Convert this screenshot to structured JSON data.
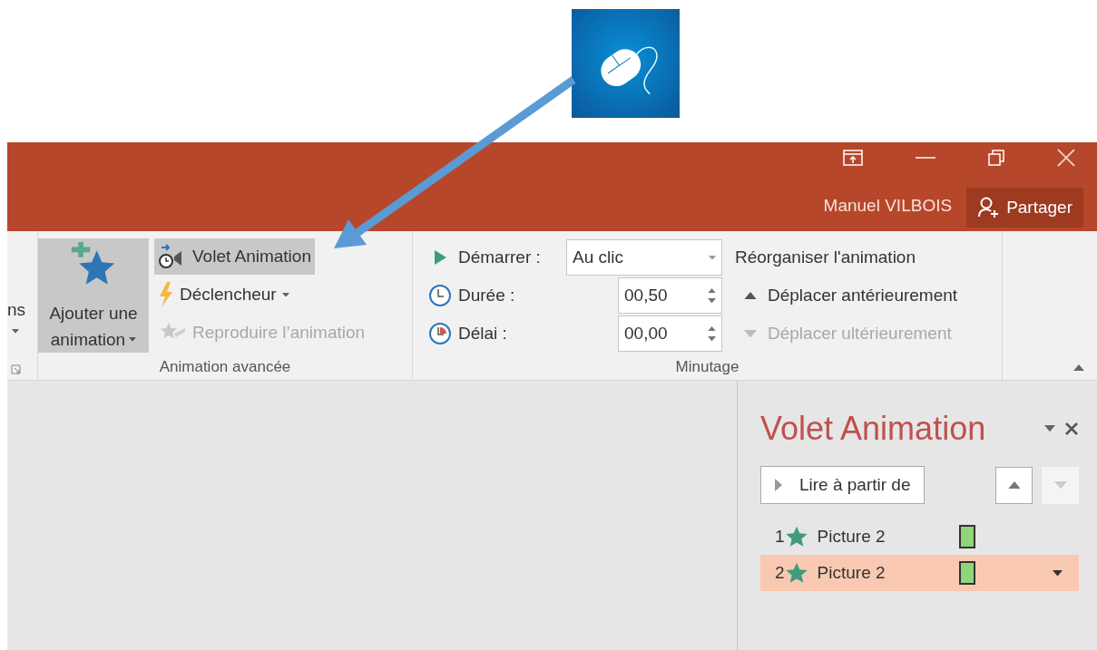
{
  "title_bar": {
    "user": "Manuel VILBOIS",
    "share_button": "Partager"
  },
  "ribbon": {
    "partial_group": {
      "label": "ns"
    },
    "advanced_group": {
      "label": "Animation avancée",
      "add_button": {
        "line1": "Ajouter une",
        "line2": "animation",
        "highlighted": true
      },
      "items": [
        {
          "kind": "pane",
          "label": "Volet Animation",
          "highlighted": true,
          "disabled": false
        },
        {
          "kind": "trigger",
          "label": "Déclencheur",
          "highlighted": false,
          "disabled": false
        },
        {
          "kind": "painter",
          "label": "Reproduire l’animation",
          "highlighted": false,
          "disabled": true
        }
      ]
    },
    "timing_group": {
      "label": "Minutage",
      "fields": [
        {
          "kind": "dropdown",
          "label": "Démarrer :",
          "value": "Au clic"
        },
        {
          "kind": "duration",
          "label": "Durée :",
          "value": "00,50"
        },
        {
          "kind": "delay",
          "label": "Délai :",
          "value": "00,00"
        }
      ],
      "reorder": {
        "heading": "Réorganiser l'animation",
        "buttons": [
          {
            "kind": "up",
            "label": "Déplacer antérieurement",
            "disabled": false
          },
          {
            "kind": "down",
            "label": "Déplacer ultérieurement",
            "disabled": true
          }
        ]
      }
    }
  },
  "animation_pane": {
    "title": "Volet Animation",
    "play_button": "Lire à partir de",
    "up_disabled": false,
    "down_disabled": true,
    "items": [
      {
        "number": "1",
        "name": "Picture 2",
        "selected": false
      },
      {
        "number": "2",
        "name": "Picture 2",
        "selected": true
      }
    ]
  }
}
